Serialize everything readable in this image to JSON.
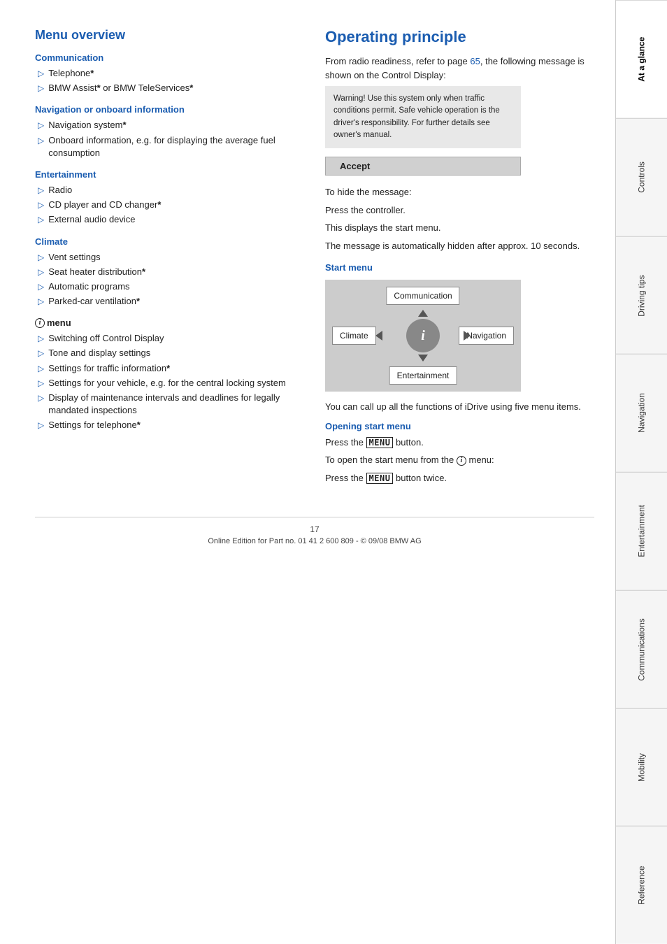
{
  "page": {
    "number": "17",
    "footer": "Online Edition for Part no. 01 41 2 600 809 - © 09/08 BMW AG"
  },
  "left": {
    "title": "Menu overview",
    "sections": [
      {
        "heading": "Communication",
        "items": [
          "Telephone*",
          "BMW Assist* or BMW TeleServices*"
        ]
      },
      {
        "heading": "Navigation or onboard information",
        "items": [
          "Navigation system*",
          "Onboard information, e.g. for displaying the average fuel consumption"
        ]
      },
      {
        "heading": "Entertainment",
        "items": [
          "Radio",
          "CD player and CD changer*",
          "External audio device"
        ]
      },
      {
        "heading": "Climate",
        "items": [
          "Vent settings",
          "Seat heater distribution*",
          "Automatic programs",
          "Parked-car ventilation*"
        ]
      }
    ],
    "imenu": {
      "label": "menu",
      "items": [
        "Switching off Control Display",
        "Tone and display settings",
        "Settings for traffic information*",
        "Settings for your vehicle, e.g. for the central locking system",
        "Display of maintenance intervals and deadlines for legally mandated inspections",
        "Settings for telephone*"
      ]
    }
  },
  "right": {
    "title": "Operating principle",
    "intro": "From radio readiness, refer to page 65, the following message is shown on the Control Display:",
    "warning": "Warning! Use this system only when traffic conditions permit. Safe vehicle operation is the driver's responsibility. For further details see owner's manual.",
    "accept_label": "Accept",
    "hide_text": "To hide the message:",
    "press_controller": "Press the controller.",
    "displays_start": "This displays the start menu.",
    "auto_hide": "The message is automatically hidden after approx. 10 seconds.",
    "start_menu": {
      "heading": "Start menu",
      "diagram": {
        "top": "Communication",
        "left": "Climate",
        "right": "Navigation",
        "bottom": "Entertainment"
      },
      "caption": "You can call up all the functions of iDrive using five menu items."
    },
    "opening": {
      "heading": "Opening start menu",
      "line1": "Press the MENU button.",
      "line2_prefix": "To open the start menu from the",
      "line2_suffix": "menu:",
      "line3": "Press the MENU button twice."
    }
  },
  "sidebar": {
    "tabs": [
      {
        "label": "At a glance",
        "active": true
      },
      {
        "label": "Controls",
        "active": false
      },
      {
        "label": "Driving tips",
        "active": false
      },
      {
        "label": "Navigation",
        "active": false
      },
      {
        "label": "Entertainment",
        "active": false
      },
      {
        "label": "Communications",
        "active": false
      },
      {
        "label": "Mobility",
        "active": false
      },
      {
        "label": "Reference",
        "active": false
      }
    ]
  }
}
